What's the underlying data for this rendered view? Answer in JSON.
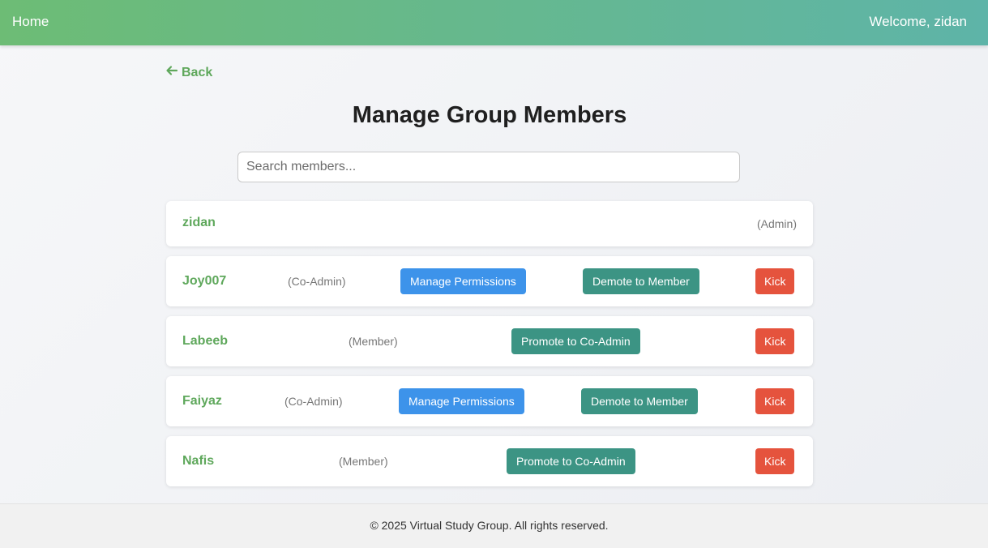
{
  "nav": {
    "home_label": "Home",
    "welcome_text": "Welcome, zidan"
  },
  "back_label": "Back",
  "page_title": "Manage Group Members",
  "search": {
    "placeholder": "Search members...",
    "value": ""
  },
  "members": [
    {
      "name": "zidan",
      "role": "(Admin)"
    },
    {
      "name": "Joy007",
      "role": "(Co-Admin)",
      "permissions_label": "Manage Permissions",
      "demote_label": "Demote to Member",
      "kick_label": "Kick"
    },
    {
      "name": "Labeeb",
      "role": "(Member)",
      "promote_label": "Promote to Co-Admin",
      "kick_label": "Kick"
    },
    {
      "name": "Faiyaz",
      "role": "(Co-Admin)",
      "permissions_label": "Manage Permissions",
      "demote_label": "Demote to Member",
      "kick_label": "Kick"
    },
    {
      "name": "Nafis",
      "role": "(Member)",
      "promote_label": "Promote to Co-Admin",
      "kick_label": "Kick"
    }
  ],
  "footer_text": "© 2025 Virtual Study Group. All rights reserved.",
  "colors": {
    "accent_green": "#5fa85c",
    "button_blue": "#3d93ea",
    "button_teal": "#3c9484",
    "button_red": "#e5533d"
  }
}
